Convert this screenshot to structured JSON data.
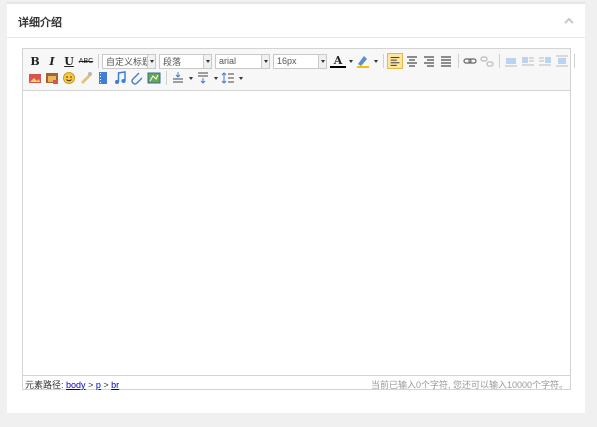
{
  "panel": {
    "title": "详细介绍",
    "collapse_icon": "chevron-up-icon"
  },
  "toolbar": {
    "bold": "B",
    "italic": "I",
    "underline": "U",
    "strike": "ABC",
    "custom_title_select": "自定义标题",
    "paragraph_select": "段落",
    "font_family_select": "arial",
    "font_size_select": "16px",
    "font_color": "A"
  },
  "statusbar": {
    "path_prefix": "元素路径:",
    "path_body": "body",
    "path_sep1": ">",
    "path_p": "p",
    "path_sep2": ">",
    "path_br": "br",
    "word_count": "当前已输入0个字符, 您还可以输入10000个字符。"
  },
  "colors": {
    "active_bg": "#ffe69f",
    "link": "#0000cc",
    "icon_blue": "#3c7ed8"
  }
}
